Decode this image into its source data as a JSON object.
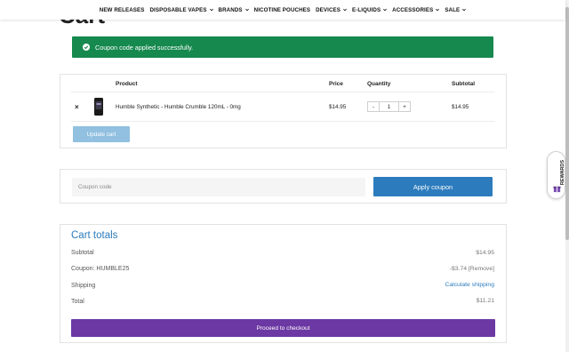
{
  "page": {
    "heading": "Cart"
  },
  "nav": {
    "items": [
      {
        "label": "NEW RELEASES",
        "dropdown": false
      },
      {
        "label": "DISPOSABLE VAPES",
        "dropdown": true
      },
      {
        "label": "BRANDS",
        "dropdown": true
      },
      {
        "label": "NICOTINE POUCHES",
        "dropdown": false
      },
      {
        "label": "DEVICES",
        "dropdown": true
      },
      {
        "label": "E-LIQUIDS",
        "dropdown": true
      },
      {
        "label": "ACCESSORIES",
        "dropdown": true
      },
      {
        "label": "SALE",
        "dropdown": true
      }
    ]
  },
  "notice": {
    "message": "Coupon code applied successfully."
  },
  "cart": {
    "headers": {
      "product": "Product",
      "price": "Price",
      "quantity": "Quantity",
      "subtotal": "Subtotal"
    },
    "item": {
      "remove": "×",
      "name": "Humble Synthetic - Humble Crumble 120mL - 0mg",
      "price": "$14.95",
      "quantity": "1",
      "subtotal": "$14.95"
    },
    "update_label": "Update cart"
  },
  "coupon": {
    "placeholder": "Coupon code",
    "apply_label": "Apply coupon"
  },
  "totals": {
    "title": "Cart totals",
    "subtotal_label": "Subtotal",
    "subtotal_value": "$14.95",
    "coupon_label": "Coupon: HUMBLE25",
    "coupon_value": "-$3.74",
    "coupon_remove": "[Remove]",
    "shipping_label": "Shipping",
    "shipping_value": "Calculate shipping",
    "total_label": "Total",
    "total_value": "$11.21",
    "checkout_label": "Proceed to checkout"
  },
  "rewards": {
    "label": "REWARDS"
  },
  "colors": {
    "success": "#16894e",
    "primary": "#2c7bbd",
    "checkout": "#6c38a3",
    "update_disabled": "#91c0e0"
  },
  "icons": {
    "check": "check-circle-icon",
    "chevron": "chevron-down-icon",
    "gift": "gift-icon",
    "product": "product-thumbnail"
  }
}
